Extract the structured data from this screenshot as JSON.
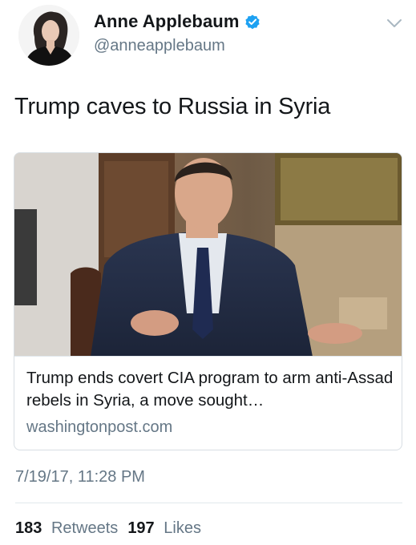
{
  "user": {
    "display_name": "Anne Applebaum",
    "handle": "@anneapplebaum",
    "verified": true,
    "verified_icon": "verified-badge-icon",
    "verified_color": "#1da1f2"
  },
  "menu_icon": "chevron-down-icon",
  "tweet": {
    "text": "Trump caves to Russia in Syria"
  },
  "card": {
    "title": "Trump ends covert CIA program to arm anti-Assad rebels in Syria, a move sought…",
    "domain": "washingtonpost.com"
  },
  "meta": {
    "timestamp": "7/19/17, 11:28 PM"
  },
  "stats": {
    "retweets_count": "183",
    "retweets_label": "Retweets",
    "likes_count": "197",
    "likes_label": "Likes"
  },
  "colors": {
    "text_primary": "#14171a",
    "text_secondary": "#657786",
    "border": "#e1e8ed"
  }
}
